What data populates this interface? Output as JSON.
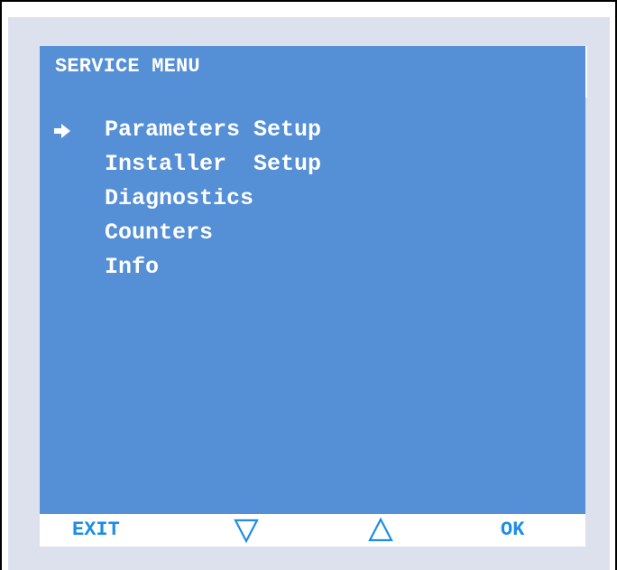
{
  "screen": {
    "title": "SERVICE MENU"
  },
  "menu": {
    "selected_index": 0,
    "items": [
      {
        "label": "Parameters Setup",
        "selected": true
      },
      {
        "label": "Installer  Setup",
        "selected": false
      },
      {
        "label": "Diagnostics",
        "selected": false
      },
      {
        "label": "Counters",
        "selected": false
      },
      {
        "label": "Info",
        "selected": false
      }
    ]
  },
  "softkeys": {
    "exit_label": "EXIT",
    "down_icon": "down-triangle-outline-icon",
    "up_icon": "up-triangle-outline-icon",
    "ok_label": "OK"
  },
  "colors": {
    "screen_background": "#558fd6",
    "bezel": "#dde1ee",
    "text": "#ffffff",
    "softkey_accent": "#1d8de6"
  }
}
